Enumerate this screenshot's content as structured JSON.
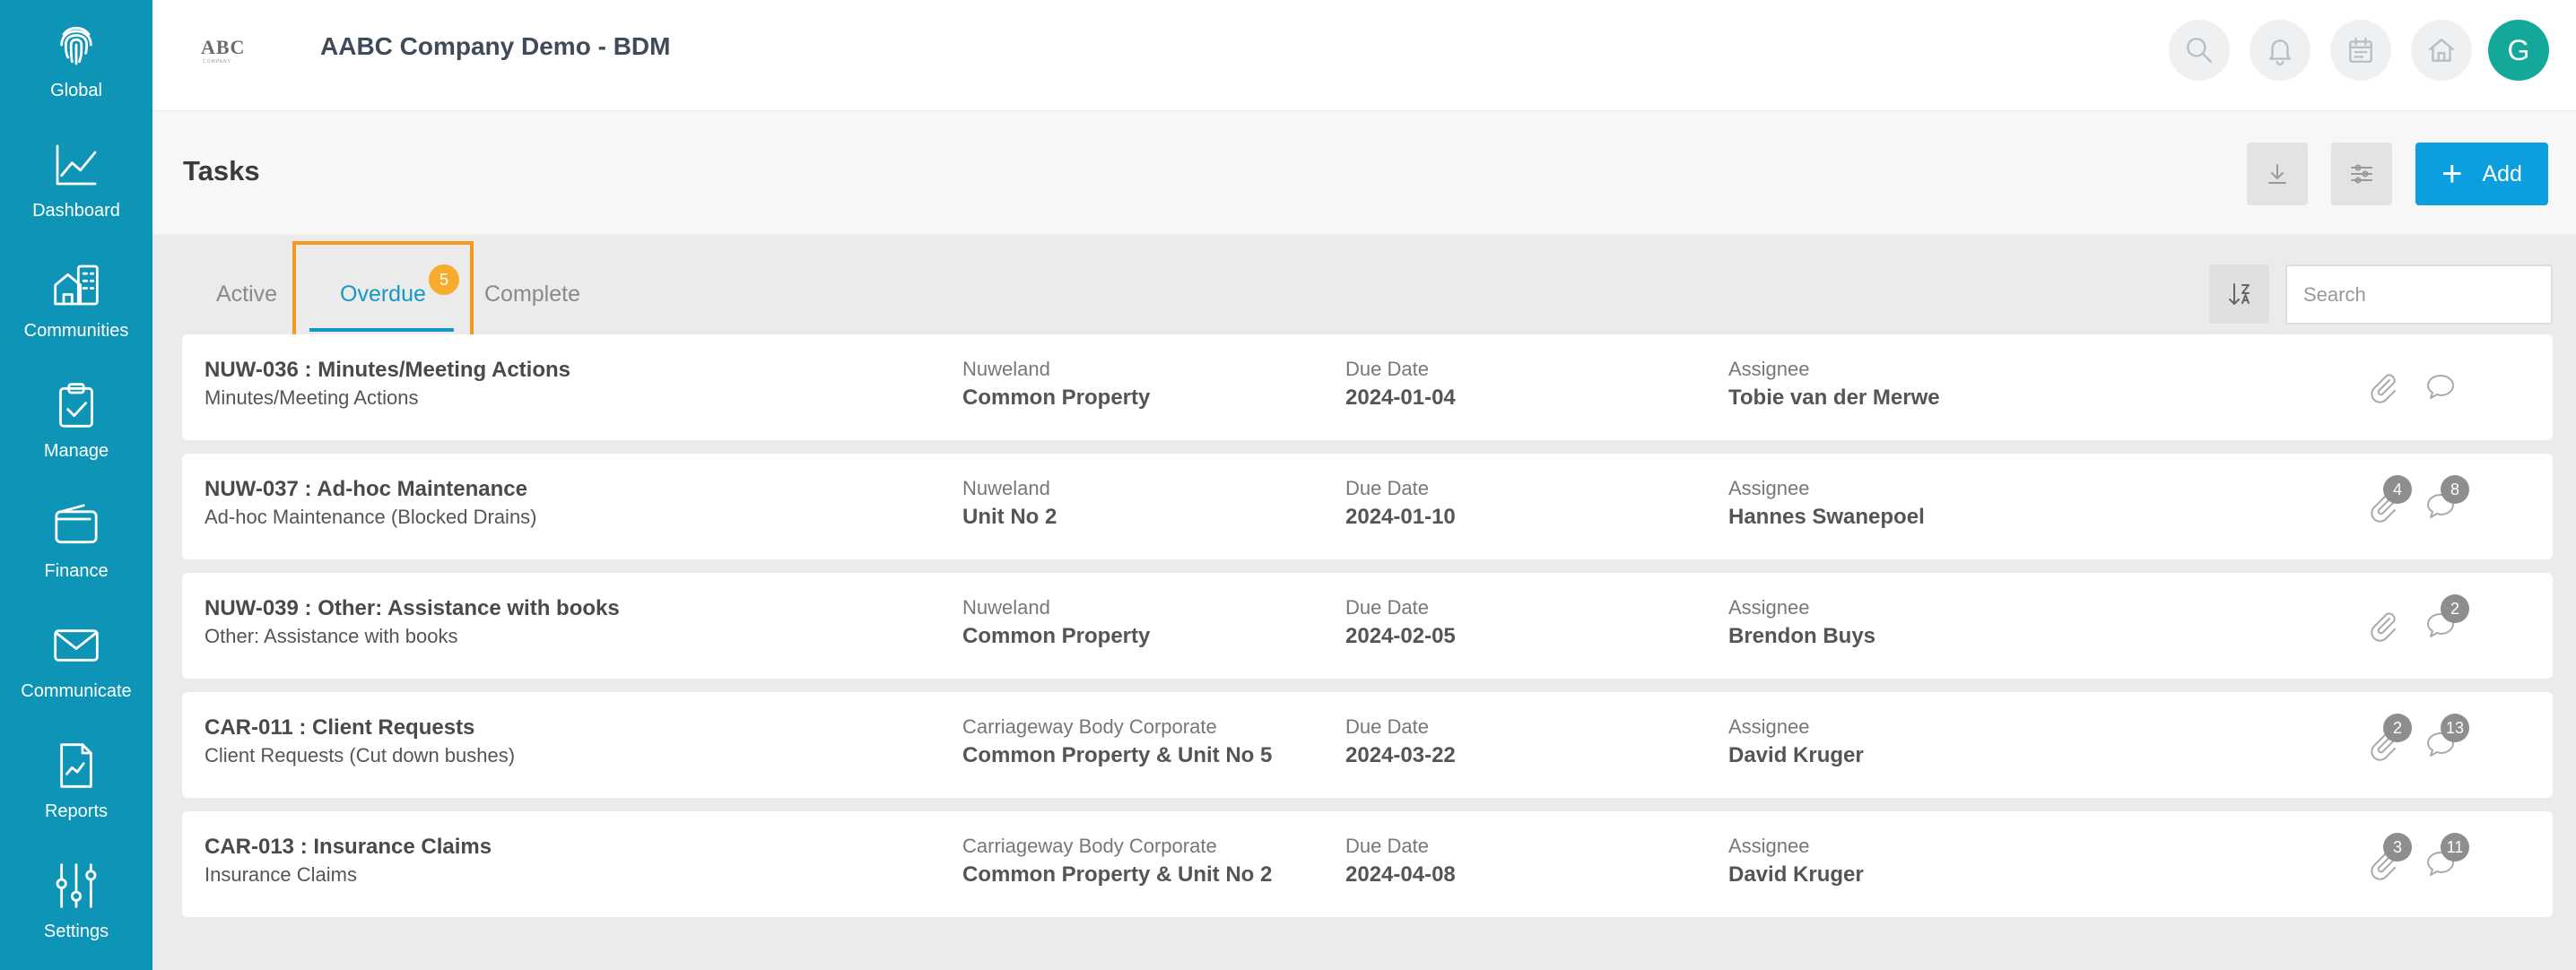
{
  "sidebar": {
    "items": [
      {
        "label": "Global",
        "icon": "fingerprint-icon"
      },
      {
        "label": "Dashboard",
        "icon": "line-chart-icon"
      },
      {
        "label": "Communities",
        "icon": "buildings-icon"
      },
      {
        "label": "Manage",
        "icon": "clipboard-check-icon"
      },
      {
        "label": "Finance",
        "icon": "wallet-icon"
      },
      {
        "label": "Communicate",
        "icon": "envelope-icon"
      },
      {
        "label": "Reports",
        "icon": "report-icon"
      },
      {
        "label": "Settings",
        "icon": "sliders-icon"
      }
    ],
    "background": "#0d94b6"
  },
  "header": {
    "logo_text": "ABC",
    "logo_subtext": "COMPANY",
    "title": "AABC Company Demo - BDM",
    "avatar_initial": "G",
    "avatar_color": "#14a89a"
  },
  "toolbar": {
    "page_title": "Tasks",
    "add_label": "Add",
    "add_color": "#0b9fe0"
  },
  "tabs": {
    "active_label": "Active",
    "overdue_label": "Overdue",
    "overdue_count": "5",
    "complete_label": "Complete",
    "selected": "Overdue",
    "highlight_color": "#f39a1e"
  },
  "search": {
    "placeholder": "Search",
    "value": ""
  },
  "tasks": [
    {
      "title": "NUW-036 : Minutes/Meeting Actions",
      "subtitle": "Minutes/Meeting Actions",
      "community": "Nuweland",
      "unit": "Common Property",
      "due_label": "Due Date",
      "due_date": "2024-01-04",
      "assignee_label": "Assignee",
      "assignee": "Tobie van der Merwe",
      "attachments": "",
      "comments": ""
    },
    {
      "title": "NUW-037 : Ad-hoc Maintenance",
      "subtitle": "Ad-hoc Maintenance (Blocked Drains)",
      "community": "Nuweland",
      "unit": "Unit No 2",
      "due_label": "Due Date",
      "due_date": "2024-01-10",
      "assignee_label": "Assignee",
      "assignee": "Hannes Swanepoel",
      "attachments": "4",
      "comments": "8"
    },
    {
      "title": "NUW-039 : Other: Assistance with books",
      "subtitle": "Other: Assistance with books",
      "community": "Nuweland",
      "unit": "Common Property",
      "due_label": "Due Date",
      "due_date": "2024-02-05",
      "assignee_label": "Assignee",
      "assignee": "Brendon Buys",
      "attachments": "",
      "comments": "2"
    },
    {
      "title": "CAR-011 : Client Requests",
      "subtitle": "Client Requests (Cut down bushes)",
      "community": "Carriageway Body Corporate",
      "unit": "Common Property & Unit No 5",
      "due_label": "Due Date",
      "due_date": "2024-03-22",
      "assignee_label": "Assignee",
      "assignee": "David Kruger",
      "attachments": "2",
      "comments": "13"
    },
    {
      "title": "CAR-013 : Insurance Claims",
      "subtitle": "Insurance Claims",
      "community": "Carriageway Body Corporate",
      "unit": "Common Property & Unit No 2",
      "due_label": "Due Date",
      "due_date": "2024-04-08",
      "assignee_label": "Assignee",
      "assignee": "David Kruger",
      "attachments": "3",
      "comments": "11"
    }
  ]
}
